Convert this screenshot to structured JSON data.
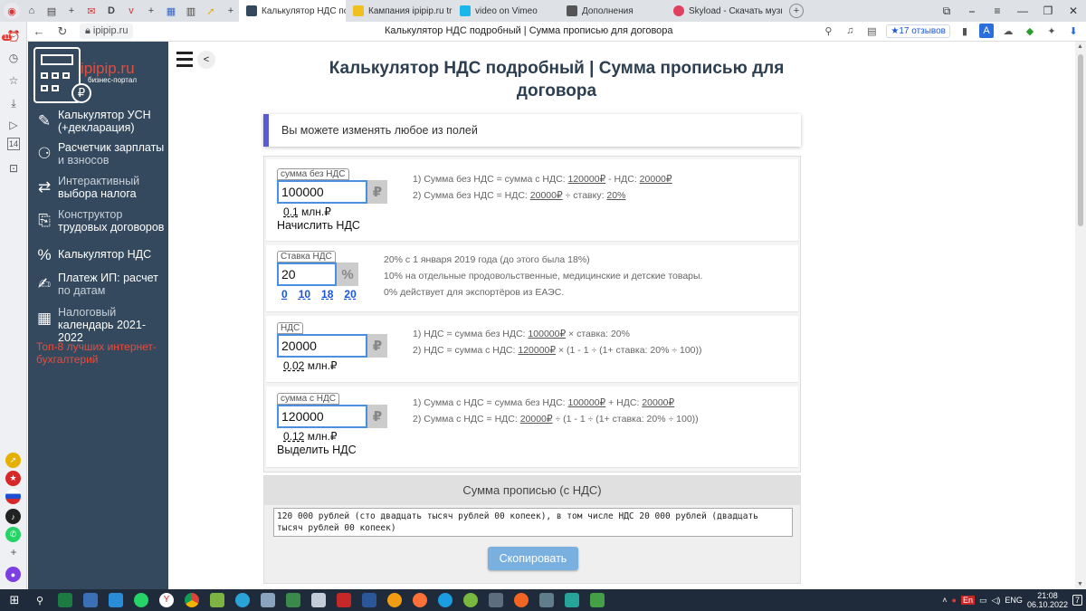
{
  "browser": {
    "tabs": [
      {
        "label": "Калькулятор НДС подр",
        "active": true
      },
      {
        "label": "Кампания ipipip.ru trudov"
      },
      {
        "label": "video on Vimeo"
      },
      {
        "label": "Дополнения"
      },
      {
        "label": "Skyload - Скачать музы"
      }
    ],
    "tab_close": "✕",
    "new_tab": "+",
    "url": "ipipip.ru",
    "page_title": "Калькулятор НДС подробный | Сумма прописью для договора",
    "reviews": "★17 отзывов",
    "badge_count": "11"
  },
  "site": {
    "logo_name": "ipipip.ru",
    "logo_sub": "бизнес-портал",
    "coin_symbol": "₽",
    "menu": [
      {
        "line1": "Калькулятор УСН",
        "line2": "(+декларация)",
        "icon": "calculator-doc-icon"
      },
      {
        "line1": "Расчетчик зарплаты",
        "line2": "и взносов",
        "icon": "payroll-icon"
      },
      {
        "line1": "Интерактивный",
        "line2": "выбора налога",
        "icon": "tax-choice-icon"
      },
      {
        "line1": "Конструктор",
        "line2": "трудовых договоров",
        "icon": "contract-icon"
      },
      {
        "line1": "Калькулятор НДС",
        "line2": "",
        "icon": "vat-icon"
      },
      {
        "line1": "Платеж ИП: расчет",
        "line2": "по датам",
        "icon": "payment-icon"
      },
      {
        "line1": "Налоговый",
        "line2": "календарь 2021-2022",
        "icon": "calendar-icon"
      }
    ],
    "side_link": "Топ-8 лучших интернет-бухгалтерий"
  },
  "page": {
    "title": "Калькулятор НДС подробный | Сумма прописью для договора",
    "info": "Вы можете изменять любое из полей"
  },
  "form": {
    "without_vat": {
      "legend": "сумма без НДС",
      "value": "100000",
      "unit": "₽",
      "mln_value": "0.1",
      "mln_unit": " млн.₽",
      "action": "Начислить НДС",
      "f1_prefix": "1) Сумма без НДС = сумма с НДС: ",
      "f1_a": "120000₽",
      "f1_mid": " - НДС: ",
      "f1_b": "20000₽",
      "f2_prefix": "2) Сумма без НДС = НДС: ",
      "f2_a": "20000₽",
      "f2_mid": " ÷ ставку: ",
      "f2_b": "20%"
    },
    "rate": {
      "legend": "Ставка НДС",
      "value": "20",
      "unit": "%",
      "options": [
        "0",
        "10",
        "18",
        "20"
      ],
      "note1": "20% с 1 января 2019 года (до этого была 18%)",
      "note2": "10% на отдельные продовольственные, медицинские и детские товары.",
      "note3": "0% действует для экспортёров из ЕАЭС."
    },
    "vat": {
      "legend": "НДС",
      "value": "20000",
      "unit": "₽",
      "mln_value": "0.02",
      "mln_unit": " млн.₽",
      "f1_prefix": "1) НДС = сумма без НДС: ",
      "f1_a": "100000₽",
      "f1_rest": " × ставка: 20%",
      "f2_prefix": "2) НДС = сумма с НДС: ",
      "f2_a": "120000₽",
      "f2_rest": " × (1 - 1 ÷ (1+ ставка: 20% ÷ 100))"
    },
    "with_vat": {
      "legend": "сумма с НДС",
      "value": "120000",
      "unit": "₽",
      "mln_value": "0.12",
      "mln_unit": " млн.₽",
      "action": "Выделить НДС",
      "f1_prefix": "1) Сумма с НДС = сумма без НДС: ",
      "f1_a": "100000₽",
      "f1_mid": " + НДС: ",
      "f1_b": "20000₽",
      "f2_prefix": "2) Сумма с НДС = НДС: ",
      "f2_a": "20000₽",
      "f2_rest": " ÷ (1 - 1 ÷ (1+ ставка: 20% ÷ 100))"
    }
  },
  "words": {
    "header": "Сумма прописью (с НДС)",
    "text": "120 000 рублей (сто двадцать тысяч рублей 00 копеек), в том числе НДС 20 000 рублей (двадцать тысяч рублей 00 копеек)",
    "copy_label": "Скопировать"
  },
  "taskbar": {
    "lang": "ENG",
    "time": "21:08",
    "date": "06.10.2022",
    "tray_lang": "En",
    "notif_count": "7"
  },
  "colors": {
    "site_sidebar": "#34495e",
    "accent_red": "#e74c3c",
    "info_accent": "#5b5bd6",
    "field_border": "#4a90e2",
    "copy_button": "#7ab0e0"
  }
}
